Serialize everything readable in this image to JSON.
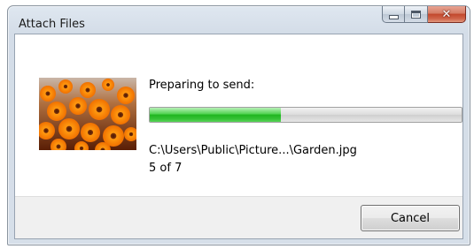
{
  "window": {
    "title": "Attach Files",
    "buttons": {
      "minimize": "minimize-icon",
      "maximize": "maximize-icon",
      "close": "close-icon",
      "close_glyph": "✕"
    }
  },
  "content": {
    "thumbnail": "Garden.jpg thumbnail (orange flowers)",
    "status_text": "Preparing to send:",
    "progress_fraction": 0.42,
    "progress_color": "#2dbb2d",
    "file_path": "C:\\Users\\Public\\Picture...\\Garden.jpg",
    "count_text": "5 of 7"
  },
  "footer": {
    "cancel_label": "Cancel"
  }
}
